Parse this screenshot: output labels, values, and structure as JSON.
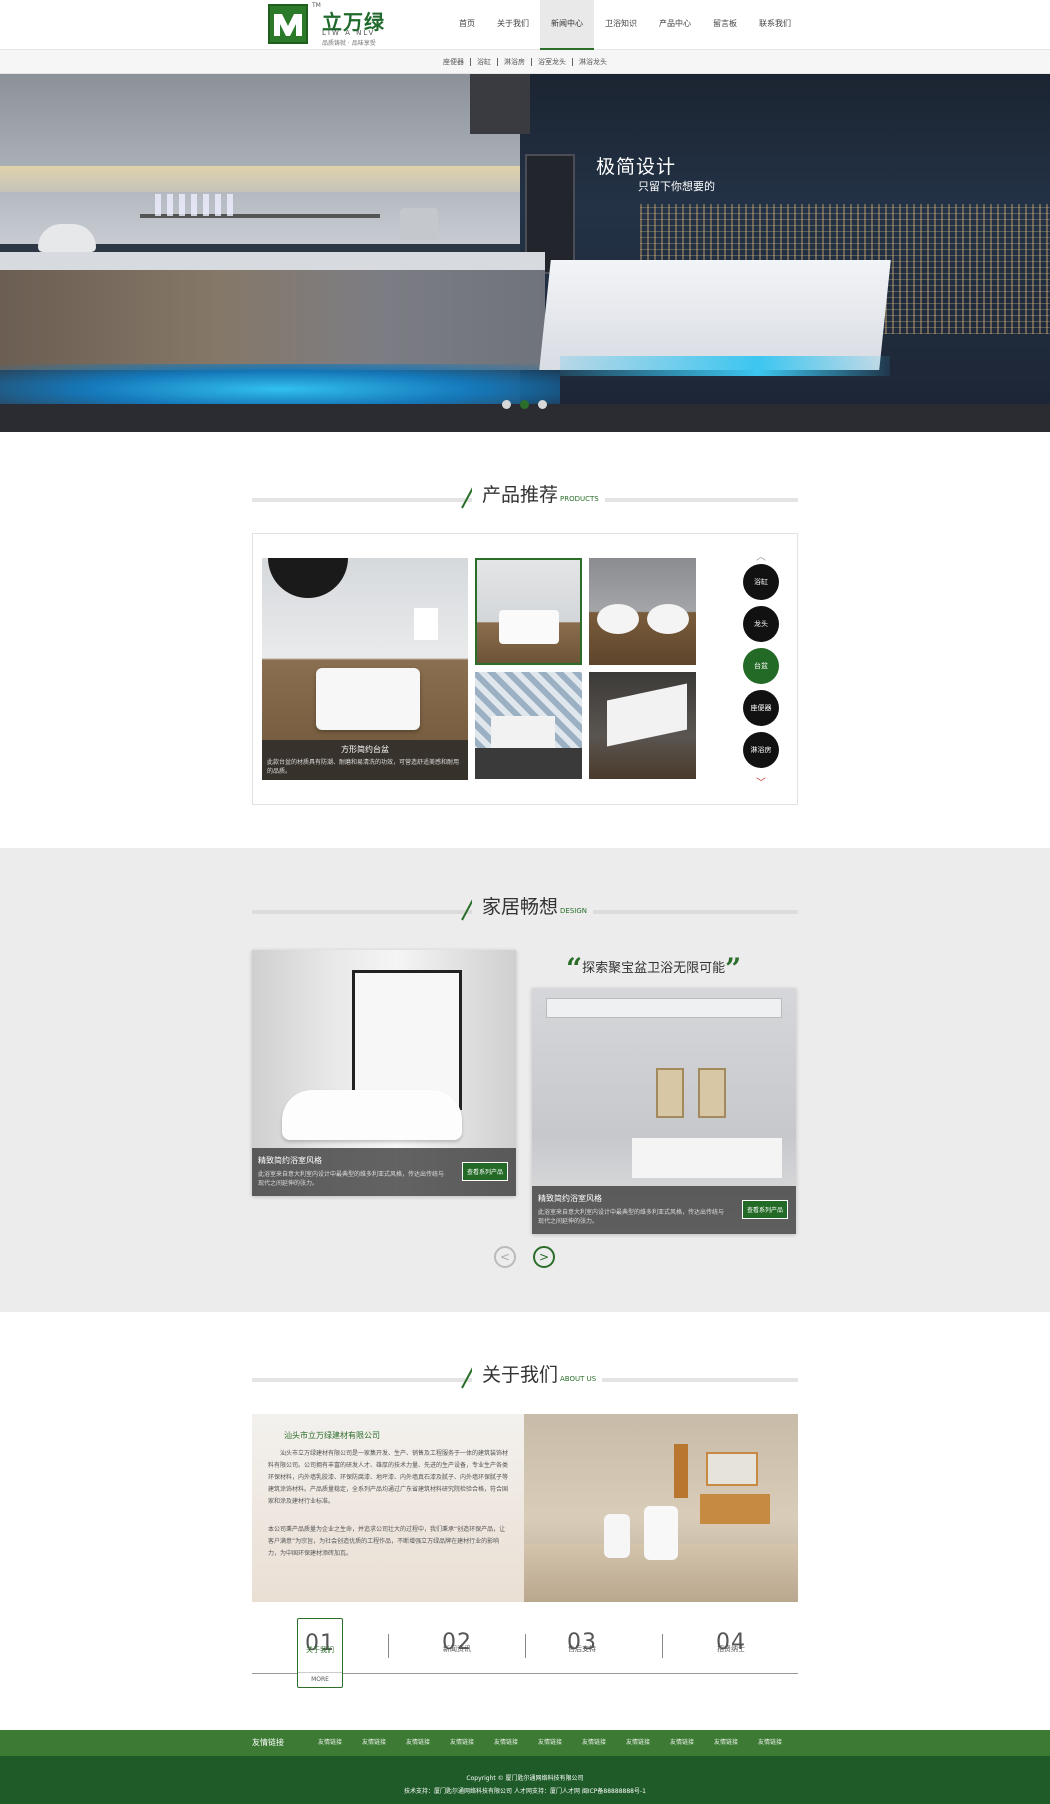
{
  "brand": {
    "tm": "TM",
    "name_cn": "立万绿",
    "name_en": "LIW A NLV",
    "slogan": "品质铸就 · 品味享受",
    "accent": "#2a6e2a"
  },
  "nav": {
    "items": [
      {
        "label": "首页",
        "active": false
      },
      {
        "label": "关于我们",
        "active": false
      },
      {
        "label": "新闻中心",
        "active": true
      },
      {
        "label": "卫浴知识",
        "active": false
      },
      {
        "label": "产品中心",
        "active": false
      },
      {
        "label": "留言板",
        "active": false
      },
      {
        "label": "联系我们",
        "active": false
      }
    ]
  },
  "subnav": [
    "座便器",
    "浴缸",
    "淋浴房",
    "浴室龙头",
    "淋浴龙头"
  ],
  "banner": {
    "title": "极简设计",
    "subtitle": "只留下你想要的",
    "slides": 3,
    "active_slide": 2
  },
  "products": {
    "heading": "产品推荐",
    "heading_en": "PRODUCTS",
    "featured": {
      "title": "方形简约台盆",
      "desc": "此款台盆的材质具有防潮、耐磨和易清洗的功效，可营造舒适美感和耐用的品质。"
    },
    "categories": [
      {
        "label": "浴缸",
        "active": false
      },
      {
        "label": "龙头",
        "active": false
      },
      {
        "label": "台盆",
        "active": true
      },
      {
        "label": "座便器",
        "active": false
      },
      {
        "label": "淋浴房",
        "active": false
      }
    ]
  },
  "design": {
    "heading": "家居畅想",
    "heading_en": "DESIGN",
    "quote": "探索聚宝盆卫浴无限可能",
    "cards": [
      {
        "title": "精致简约浴室风格",
        "desc": "此浴室来自意大利室内设计中最典型的维多利亚式风格，传达出传统与现代之间延伸的张力。",
        "button": "查看系列产品"
      },
      {
        "title": "精致简约浴室风格",
        "desc": "此浴室来自意大利室内设计中最典型的维多利亚式风格，传达出传统与现代之间延伸的张力。",
        "button": "查看系列产品"
      }
    ],
    "prev": "<",
    "next": ">"
  },
  "about": {
    "heading": "关于我们",
    "heading_en": "ABOUT US",
    "company": "汕头市立万绿建材有限公司",
    "p1": "汕头市立万绿建材有限公司是一家集开发、生产、销售及工程服务于一体的建筑装饰材料有限公司。公司拥有丰富的研发人才、雄厚的技术力量、先进的生产设备，专业生产各类环保材料，内外墙乳胶漆、环保防腐漆、地坪漆、内外墙真石漆及腻子、内外墙环保腻子等建筑涂饰材料。产品质量稳定，全系列产品均通过广东省建筑材料研究院检验合格，符合国家和涂及建材行业标准。",
    "p2": "本公司秉产品质量为企业之生命，并追求公司壮大的过程中，我们秉承“创造环保产品，让客户满意”为宗旨，为社会创造优质的工程作品，不断增强立万绿品牌在建材行业的影响力，为中国环保建材添砖加瓦。",
    "tabs": [
      {
        "num": "01",
        "label": "关于我们",
        "more": "MORE",
        "active": true
      },
      {
        "num": "02",
        "label": "新闻资讯",
        "active": false
      },
      {
        "num": "03",
        "label": "售后支持",
        "active": false
      },
      {
        "num": "04",
        "label": "招贤纳士",
        "active": false
      }
    ]
  },
  "links": {
    "title": "友情链接",
    "items": [
      "友情链接",
      "友情链接",
      "友情链接",
      "友情链接",
      "友情链接",
      "友情链接",
      "友情链接",
      "友情链接",
      "友情链接",
      "友情链接",
      "友情链接"
    ]
  },
  "footer": {
    "copyright": "Copyright © 厦门匙尔通网络科技有限公司",
    "support": "技术支持：厦门匙尔通网络科技有限公司 人才网支持：厦门人才网 闽ICP备88888888号-1"
  }
}
